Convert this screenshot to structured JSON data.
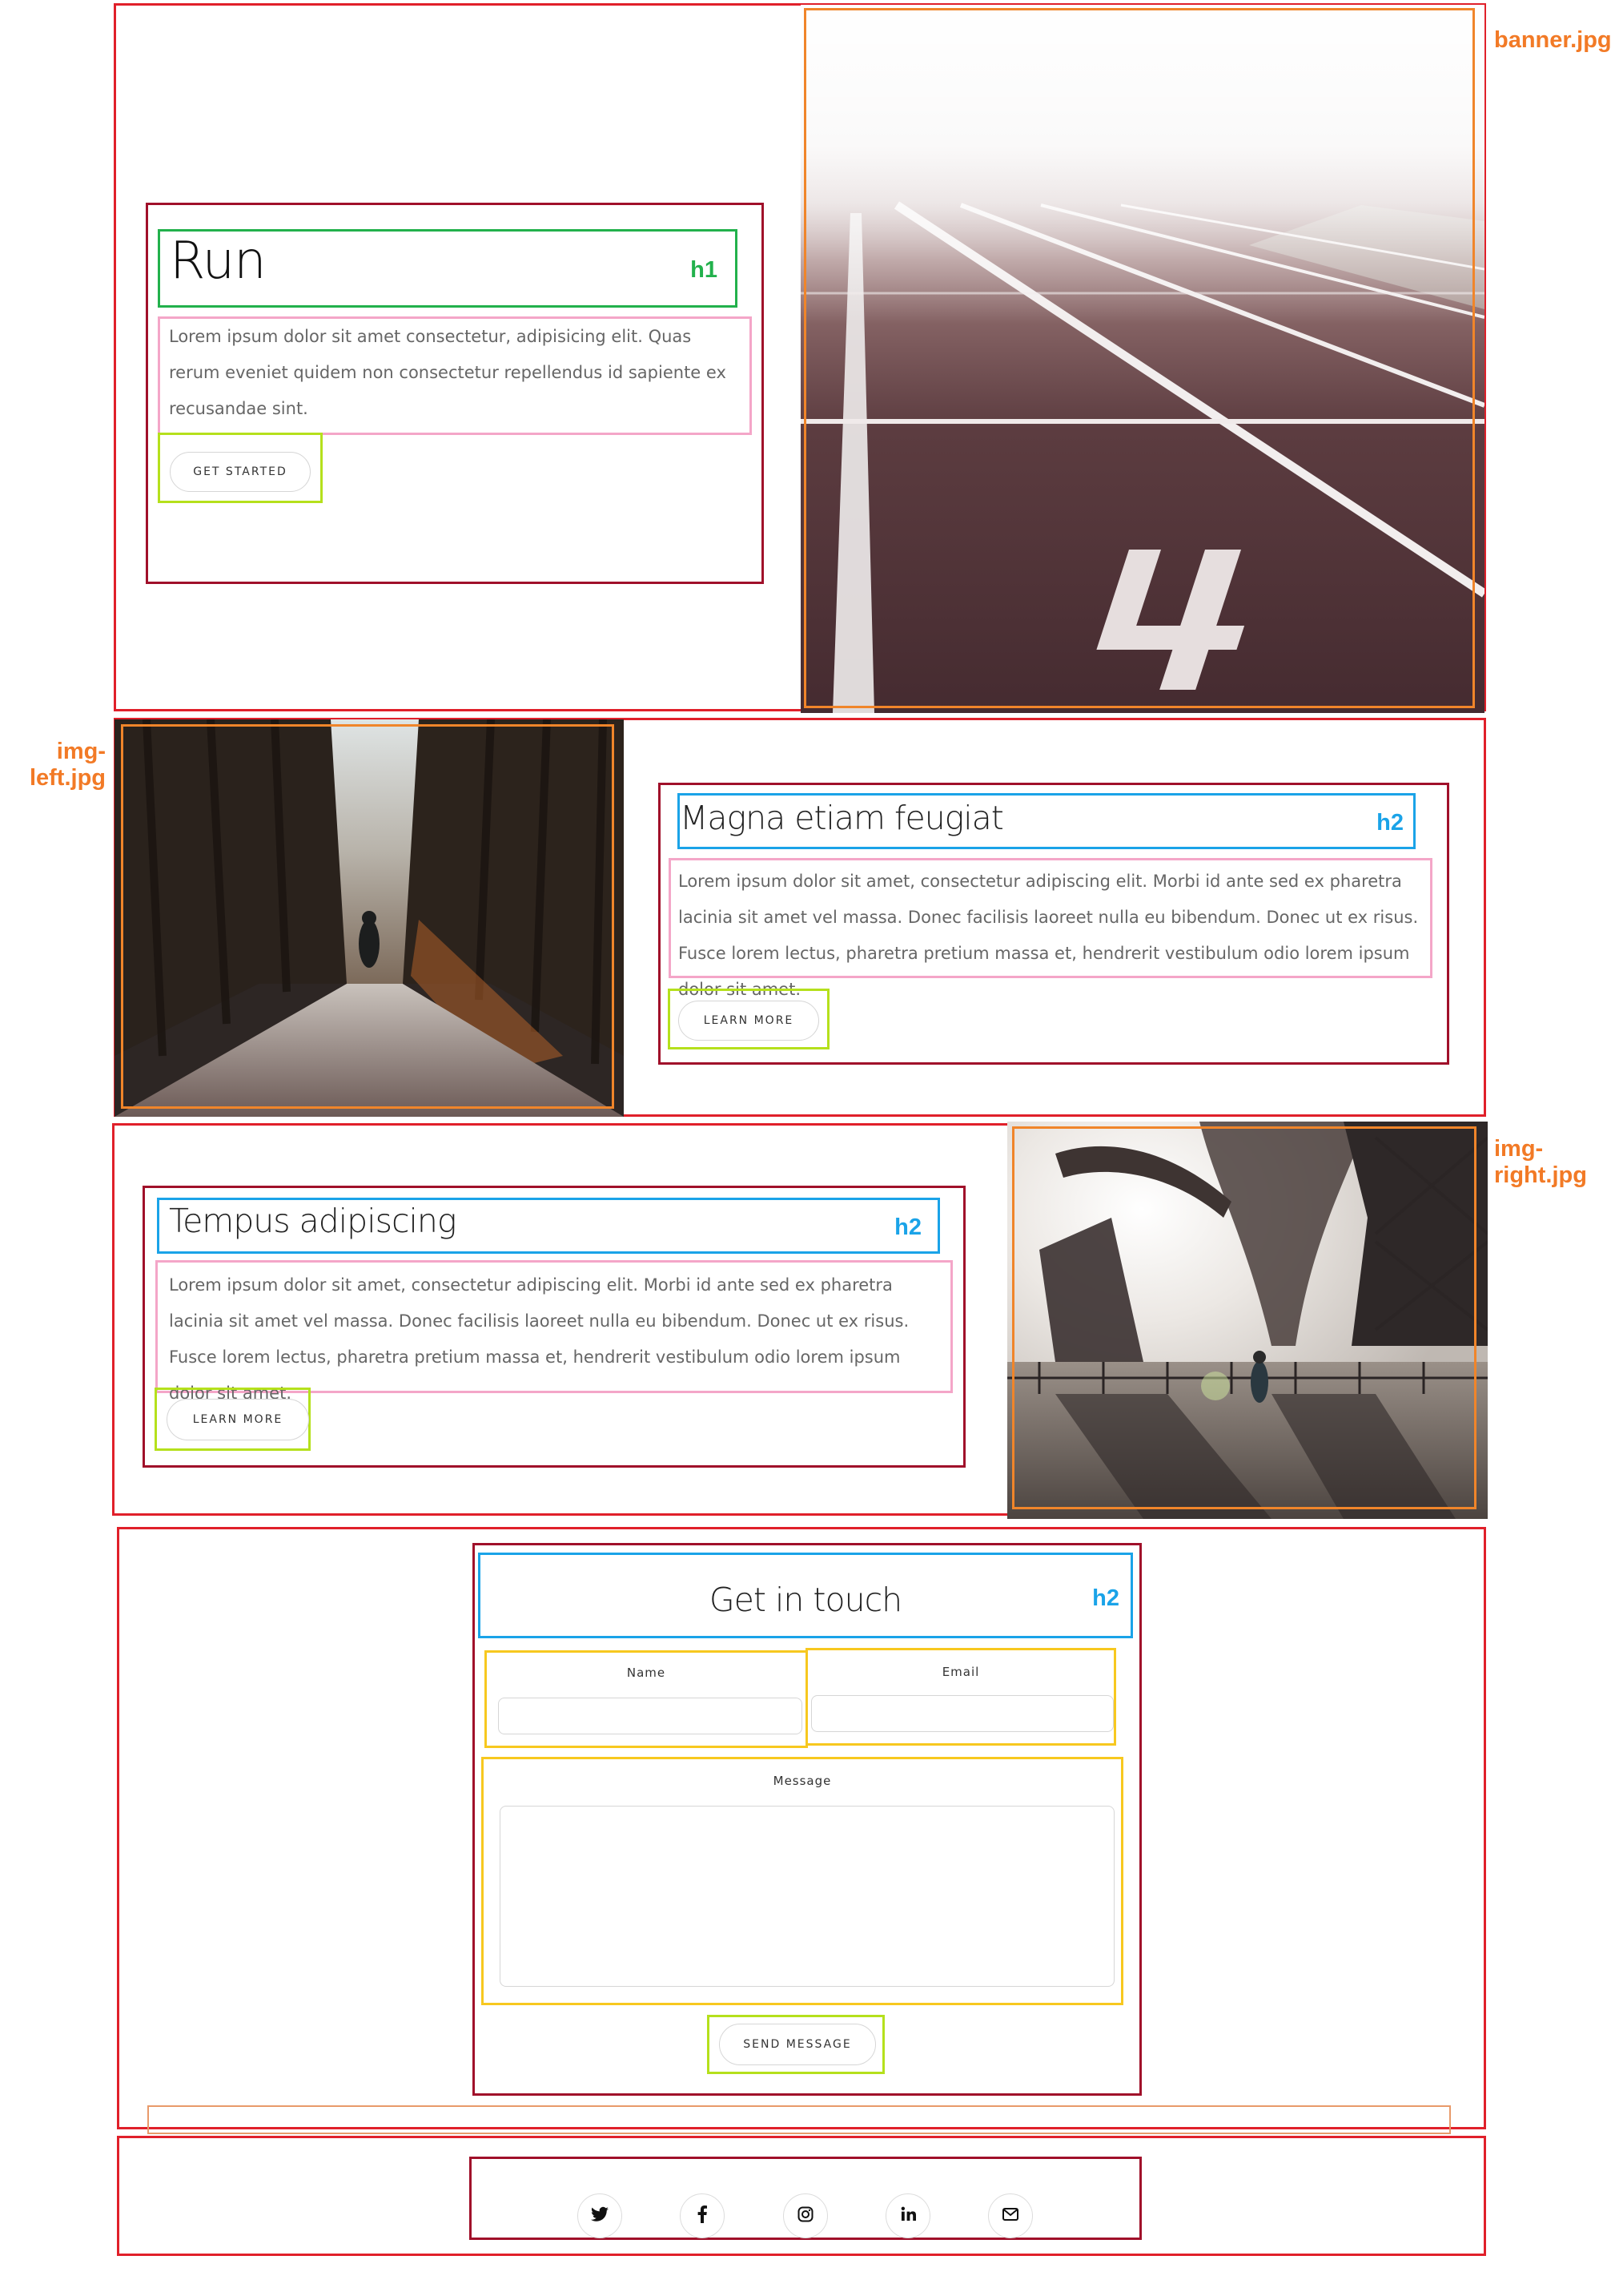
{
  "annotations": {
    "banner_label": "banner.jpg",
    "img_left_label": "img-\nleft.jpg",
    "img_right_label": "img-\nright.jpg",
    "h1_tag": "h1",
    "h2_tag": "h2"
  },
  "hero": {
    "title": "Run",
    "text": "Lorem ipsum dolor sit amet consectetur, adipisicing elit. Quas rerum eveniet quidem non consectetur repellendus id sapiente ex recusandae sint.",
    "button": "GET STARTED"
  },
  "section1": {
    "title": "Magna etiam feugiat",
    "text": "Lorem ipsum dolor sit amet, consectetur adipiscing elit. Morbi id ante sed ex pharetra lacinia sit amet vel massa. Donec facilisis laoreet nulla eu bibendum. Donec ut ex risus. Fusce lorem lectus, pharetra pretium massa et, hendrerit vestibulum odio lorem ipsum dolor sit amet.",
    "button": "LEARN MORE"
  },
  "section2": {
    "title": "Tempus adipiscing",
    "text": "Lorem ipsum dolor sit amet, consectetur adipiscing elit. Morbi id ante sed ex pharetra lacinia sit amet vel massa. Donec facilisis laoreet nulla eu bibendum. Donec ut ex risus. Fusce lorem lectus, pharetra pretium massa et, hendrerit vestibulum odio lorem ipsum dolor sit amet.",
    "button": "LEARN MORE"
  },
  "contact": {
    "title": "Get in touch",
    "name_label": "Name",
    "email_label": "Email",
    "message_label": "Message",
    "button": "SEND MESSAGE"
  },
  "footer": {
    "icons": [
      "twitter-icon",
      "facebook-icon",
      "instagram-icon",
      "linkedin-icon",
      "envelope-icon"
    ]
  },
  "colors": {
    "section_outline": "#e0202a",
    "container_outline": "#a0102a",
    "h1_outline": "#22b14c",
    "h2_outline": "#1aa3e8",
    "paragraph_outline": "#f4a6c8",
    "button_outline": "#b5e01c",
    "image_outline": "#f0852a",
    "field_outline": "#f7c81f"
  }
}
